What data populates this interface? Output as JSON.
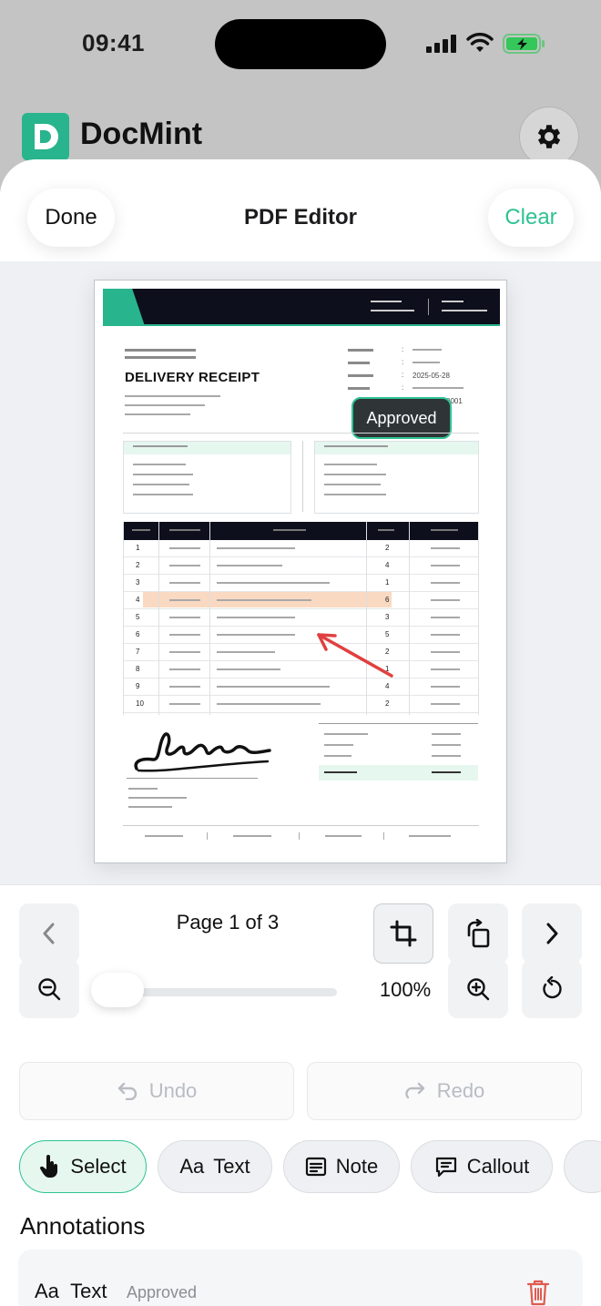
{
  "status_bar": {
    "time": "09:41"
  },
  "app": {
    "title": "DocMint",
    "logo_letter": "D"
  },
  "sheet": {
    "done_label": "Done",
    "title": "PDF Editor",
    "clear_label": "Clear"
  },
  "document": {
    "heading": "DELIVERY RECEIPT",
    "meta_colon": ":",
    "meta_date": "2025-05-28",
    "meta_ref_suffix": "0001",
    "rows": [
      {
        "num": "1",
        "qty": "2"
      },
      {
        "num": "2",
        "qty": "4"
      },
      {
        "num": "3",
        "qty": "1"
      },
      {
        "num": "4",
        "qty": "6"
      },
      {
        "num": "5",
        "qty": "3"
      },
      {
        "num": "6",
        "qty": "5"
      },
      {
        "num": "7",
        "qty": "2"
      },
      {
        "num": "8",
        "qty": "1"
      },
      {
        "num": "9",
        "qty": "4"
      },
      {
        "num": "10",
        "qty": "2"
      }
    ],
    "highlighted_row": 4
  },
  "annotation_on_page": {
    "label": "Approved"
  },
  "pager": {
    "label": "Page 1 of 3"
  },
  "zoom": {
    "label": "100%",
    "level": 0.0
  },
  "history": {
    "undo_label": "Undo",
    "redo_label": "Redo"
  },
  "tools": {
    "select_label": "Select",
    "text_prefix": "Aa",
    "text_label": "Text",
    "note_label": "Note",
    "callout_label": "Callout"
  },
  "annotations": {
    "title": "Annotations",
    "items": [
      {
        "prefix": "Aa",
        "kind": "Text",
        "content": "Approved"
      }
    ]
  },
  "colors": {
    "accent": "#2fc293",
    "dark": "#0e0f1c",
    "highlight": "#f8d2b6",
    "arrow": "#e0403f",
    "danger": "#e05a4f"
  },
  "icons": [
    "gear-icon",
    "chevron-left-icon",
    "crop-icon",
    "rotate-page-icon",
    "chevron-right-icon",
    "zoom-out-icon",
    "zoom-in-icon",
    "reset-icon",
    "undo-icon",
    "redo-icon",
    "hand-pointer-icon",
    "note-icon",
    "callout-icon",
    "trash-icon"
  ]
}
